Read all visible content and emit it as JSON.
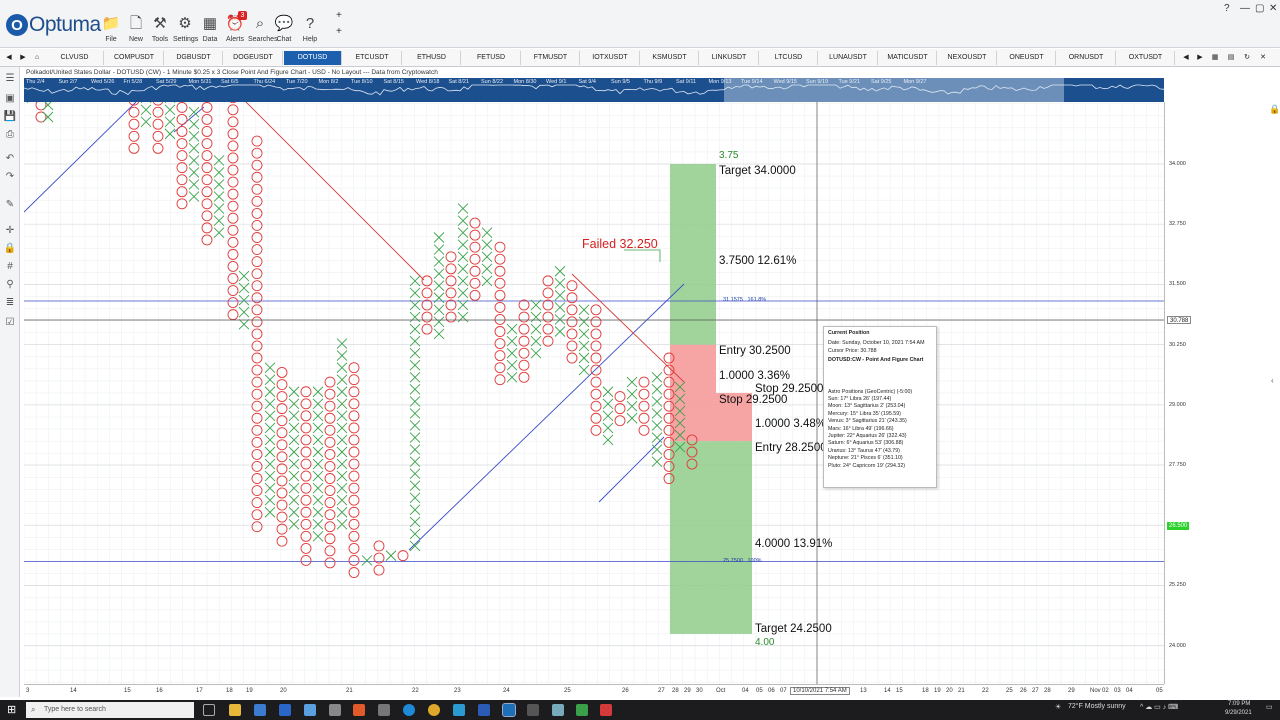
{
  "app": {
    "logo_text": "Optuma"
  },
  "toolbar": {
    "buttons": [
      {
        "name": "file",
        "label": "File",
        "icon": "📁"
      },
      {
        "name": "new",
        "label": "New",
        "icon": "🗋"
      },
      {
        "name": "tools",
        "label": "Tools",
        "icon": "⚒"
      },
      {
        "name": "settings",
        "label": "Settings",
        "icon": "⚙"
      },
      {
        "name": "data",
        "label": "Data",
        "icon": "▦"
      },
      {
        "name": "alerts",
        "label": "Alerts",
        "icon": "⏰",
        "badge": "3"
      },
      {
        "name": "searches",
        "label": "Searches",
        "icon": "⌕"
      },
      {
        "name": "chat",
        "label": "Chat",
        "icon": "💬"
      },
      {
        "name": "help",
        "label": "Help",
        "icon": "?"
      }
    ]
  },
  "symbol_tabs": [
    "CLVUSD",
    "COMPUSDT",
    "DGBUSDT",
    "DOGEUSDT",
    "DOTUSD",
    "ETCUSDT",
    "ETHUSD",
    "FETUSD",
    "FTMUSDT",
    "IOTXUSDT",
    "KSMUSDT",
    "LINKUSDT",
    "LTCUSD",
    "LUNAUSDT",
    "MATICUSDT",
    "NEXOUSDT",
    "ONEUSDT",
    "ORNUSDT",
    "OXTUSDT"
  ],
  "active_tab": "DOTUSD",
  "chart_header": "Polkadot/United States Dollar - DOTUSD (CW) - 1 Minute $0.25 x 3 Close Point And Figure Chart - USD - No Layout --- Data from Cryptowatch",
  "overview_labels": [
    "Thu 2/4",
    "Sun 2/7",
    "Wed 5/26",
    "Fri 5/28",
    "Sat 5/29",
    "Mon 5/31",
    "Sat 6/5",
    "Thu 6/24",
    "Tue 7/20",
    "Mon 8/2",
    "Tue 8/10",
    "Sat 8/15",
    "Wed 8/18",
    "Sat 8/21",
    "Sun 8/22",
    "Mon 8/30",
    "Wed 9/1",
    "Sat 9/4",
    "Sun 9/5",
    "Thu 9/9",
    "Sat 9/11",
    "Mon 9/13",
    "Tue 9/14",
    "Wed 9/15",
    "Sun 9/19",
    "Tue 9/21",
    "Sat 9/25",
    "Mon 9/27"
  ],
  "chart_annotations": {
    "target_top_label": "3.75",
    "target_top": "Target 34.0000",
    "up_move": "3.7500 12.61%",
    "failed": "Failed 32.250",
    "entry_short": "Entry 30.2500",
    "risk_short": "1.0000 3.36%",
    "stop_short": "Stop 29.2500",
    "stop_long": "Stop 29.2500",
    "risk_long": "1.0000 3.48%",
    "entry_long": "Entry 28.2500",
    "down_move": "4.0000 13.91%",
    "target_bottom": "Target 24.2500",
    "target_bottom_label": "4.00",
    "fib_upper": "31.1575",
    "fib_upper_pct": "161.8%",
    "fib_lower": "25.7500",
    "fib_lower_pct": "100%"
  },
  "y_axis": {
    "ticks": [
      "34.000",
      "32.750",
      "31.500",
      "30.250",
      "29.000",
      "27.750",
      "26.500",
      "25.250",
      "24.000"
    ],
    "cursor_tag": "30.788",
    "price_tag": "26.500",
    "price_tag_color": "#2bd12b"
  },
  "x_axis": {
    "ticks": [
      "3",
      "14",
      "15",
      "16",
      "17",
      "18",
      "19",
      "20",
      "21",
      "22",
      "23",
      "24",
      "25",
      "26",
      "27",
      "28",
      "29",
      "30",
      "Oct",
      "04",
      "05",
      "06",
      "07",
      "13",
      "14",
      "15",
      "18",
      "19",
      "20",
      "21",
      "22",
      "25",
      "26",
      "27",
      "28",
      "29",
      "Nov",
      "02",
      "03",
      "04",
      "05"
    ],
    "cursor_label": "10/10/2021 7:54 AM"
  },
  "tooltip": {
    "title": "Current Position",
    "date": "Date: Sunday, October 10, 2021 7:54 AM",
    "cursor_price": "Cursor Price: 30.788",
    "chart_name": "DOTUSD:CW - Point And Figure Chart",
    "astro_title": "Astro Positions (GeoCentric) (-5:00)",
    "astro": [
      "Sun: 17° Libra 26' (197.44)",
      "Moon: 13° Sagittarius 2' (253.04)",
      "Mercury: 15° Libra 35' (195.59)",
      "Venus: 3° Sagittarius 21' (243.35)",
      "Mars: 16° Libra 49' (196.66)",
      "Jupiter: 22° Aquarius 26' (322.43)",
      "Saturn: 6° Aquarius 53' (306.88)",
      "Uranus: 13° Taurus 47' (43.79)",
      "Neptune: 21° Pisces 6' (351.10)",
      "Pluto: 24° Capricorn 19' (294.32)"
    ]
  },
  "taskbar": {
    "search_placeholder": "Type here to search",
    "weather": "72°F  Mostly sunny",
    "time": "7:09 PM",
    "date": "9/29/2021"
  }
}
